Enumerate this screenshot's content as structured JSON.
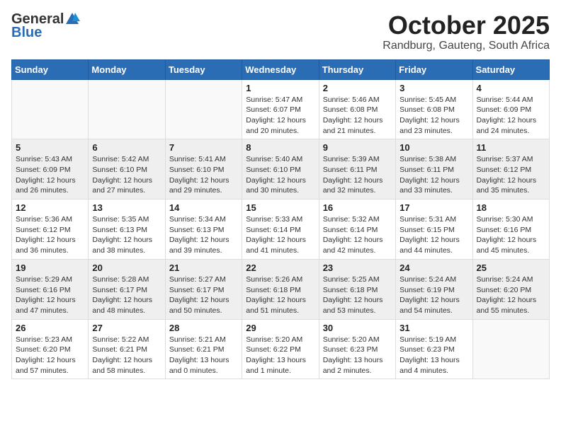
{
  "header": {
    "logo_general": "General",
    "logo_blue": "Blue",
    "month_title": "October 2025",
    "location": "Randburg, Gauteng, South Africa"
  },
  "weekdays": [
    "Sunday",
    "Monday",
    "Tuesday",
    "Wednesday",
    "Thursday",
    "Friday",
    "Saturday"
  ],
  "weeks": [
    [
      {
        "day": "",
        "info": ""
      },
      {
        "day": "",
        "info": ""
      },
      {
        "day": "",
        "info": ""
      },
      {
        "day": "1",
        "info": "Sunrise: 5:47 AM\nSunset: 6:07 PM\nDaylight: 12 hours\nand 20 minutes."
      },
      {
        "day": "2",
        "info": "Sunrise: 5:46 AM\nSunset: 6:08 PM\nDaylight: 12 hours\nand 21 minutes."
      },
      {
        "day": "3",
        "info": "Sunrise: 5:45 AM\nSunset: 6:08 PM\nDaylight: 12 hours\nand 23 minutes."
      },
      {
        "day": "4",
        "info": "Sunrise: 5:44 AM\nSunset: 6:09 PM\nDaylight: 12 hours\nand 24 minutes."
      }
    ],
    [
      {
        "day": "5",
        "info": "Sunrise: 5:43 AM\nSunset: 6:09 PM\nDaylight: 12 hours\nand 26 minutes."
      },
      {
        "day": "6",
        "info": "Sunrise: 5:42 AM\nSunset: 6:10 PM\nDaylight: 12 hours\nand 27 minutes."
      },
      {
        "day": "7",
        "info": "Sunrise: 5:41 AM\nSunset: 6:10 PM\nDaylight: 12 hours\nand 29 minutes."
      },
      {
        "day": "8",
        "info": "Sunrise: 5:40 AM\nSunset: 6:10 PM\nDaylight: 12 hours\nand 30 minutes."
      },
      {
        "day": "9",
        "info": "Sunrise: 5:39 AM\nSunset: 6:11 PM\nDaylight: 12 hours\nand 32 minutes."
      },
      {
        "day": "10",
        "info": "Sunrise: 5:38 AM\nSunset: 6:11 PM\nDaylight: 12 hours\nand 33 minutes."
      },
      {
        "day": "11",
        "info": "Sunrise: 5:37 AM\nSunset: 6:12 PM\nDaylight: 12 hours\nand 35 minutes."
      }
    ],
    [
      {
        "day": "12",
        "info": "Sunrise: 5:36 AM\nSunset: 6:12 PM\nDaylight: 12 hours\nand 36 minutes."
      },
      {
        "day": "13",
        "info": "Sunrise: 5:35 AM\nSunset: 6:13 PM\nDaylight: 12 hours\nand 38 minutes."
      },
      {
        "day": "14",
        "info": "Sunrise: 5:34 AM\nSunset: 6:13 PM\nDaylight: 12 hours\nand 39 minutes."
      },
      {
        "day": "15",
        "info": "Sunrise: 5:33 AM\nSunset: 6:14 PM\nDaylight: 12 hours\nand 41 minutes."
      },
      {
        "day": "16",
        "info": "Sunrise: 5:32 AM\nSunset: 6:14 PM\nDaylight: 12 hours\nand 42 minutes."
      },
      {
        "day": "17",
        "info": "Sunrise: 5:31 AM\nSunset: 6:15 PM\nDaylight: 12 hours\nand 44 minutes."
      },
      {
        "day": "18",
        "info": "Sunrise: 5:30 AM\nSunset: 6:16 PM\nDaylight: 12 hours\nand 45 minutes."
      }
    ],
    [
      {
        "day": "19",
        "info": "Sunrise: 5:29 AM\nSunset: 6:16 PM\nDaylight: 12 hours\nand 47 minutes."
      },
      {
        "day": "20",
        "info": "Sunrise: 5:28 AM\nSunset: 6:17 PM\nDaylight: 12 hours\nand 48 minutes."
      },
      {
        "day": "21",
        "info": "Sunrise: 5:27 AM\nSunset: 6:17 PM\nDaylight: 12 hours\nand 50 minutes."
      },
      {
        "day": "22",
        "info": "Sunrise: 5:26 AM\nSunset: 6:18 PM\nDaylight: 12 hours\nand 51 minutes."
      },
      {
        "day": "23",
        "info": "Sunrise: 5:25 AM\nSunset: 6:18 PM\nDaylight: 12 hours\nand 53 minutes."
      },
      {
        "day": "24",
        "info": "Sunrise: 5:24 AM\nSunset: 6:19 PM\nDaylight: 12 hours\nand 54 minutes."
      },
      {
        "day": "25",
        "info": "Sunrise: 5:24 AM\nSunset: 6:20 PM\nDaylight: 12 hours\nand 55 minutes."
      }
    ],
    [
      {
        "day": "26",
        "info": "Sunrise: 5:23 AM\nSunset: 6:20 PM\nDaylight: 12 hours\nand 57 minutes."
      },
      {
        "day": "27",
        "info": "Sunrise: 5:22 AM\nSunset: 6:21 PM\nDaylight: 12 hours\nand 58 minutes."
      },
      {
        "day": "28",
        "info": "Sunrise: 5:21 AM\nSunset: 6:21 PM\nDaylight: 13 hours\nand 0 minutes."
      },
      {
        "day": "29",
        "info": "Sunrise: 5:20 AM\nSunset: 6:22 PM\nDaylight: 13 hours\nand 1 minute."
      },
      {
        "day": "30",
        "info": "Sunrise: 5:20 AM\nSunset: 6:23 PM\nDaylight: 13 hours\nand 2 minutes."
      },
      {
        "day": "31",
        "info": "Sunrise: 5:19 AM\nSunset: 6:23 PM\nDaylight: 13 hours\nand 4 minutes."
      },
      {
        "day": "",
        "info": ""
      }
    ]
  ]
}
